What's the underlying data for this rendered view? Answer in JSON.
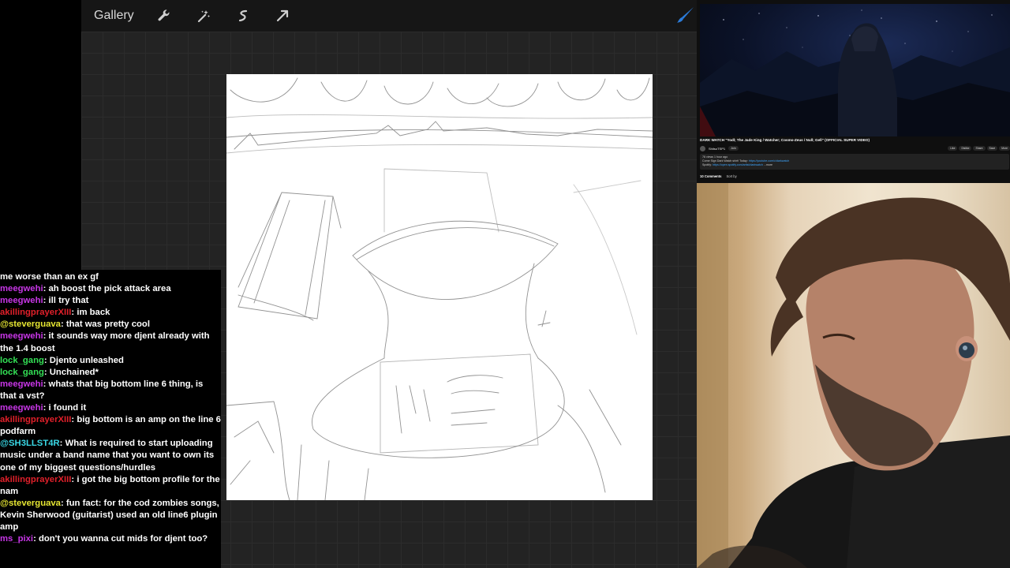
{
  "procreate": {
    "gallery_label": "Gallery",
    "tools": [
      "wrench-icon",
      "magic-wand-icon",
      "selection-icon",
      "transform-arrow-icon"
    ],
    "brush_icon": "brush-icon",
    "accent": "#2b7bd9"
  },
  "chat": {
    "messages": [
      {
        "user": "",
        "color": "#ffffff",
        "text": "me worse than an ex gf"
      },
      {
        "user": "meegwehi",
        "color": "#c736e6",
        "text": ": ah boost the pick attack area"
      },
      {
        "user": "meegwehi",
        "color": "#c736e6",
        "text": ": ill try that"
      },
      {
        "user": "akillingprayerXIII",
        "color": "#e0202a",
        "text": ": im back"
      },
      {
        "user": "@steverguava",
        "color": "#e6e633",
        "text": ": that was pretty cool"
      },
      {
        "user": "meegwehi",
        "color": "#c736e6",
        "text": ": it sounds way more djent already with the 1.4 boost"
      },
      {
        "user": "lock_gang",
        "color": "#33e055",
        "text": ": Djento unleashed"
      },
      {
        "user": "lock_gang",
        "color": "#33e055",
        "text": ": Unchained*"
      },
      {
        "user": "meegwehi",
        "color": "#c736e6",
        "text": ": whats that big bottom line 6 thing, is that a vst?"
      },
      {
        "user": "meegwehi",
        "color": "#c736e6",
        "text": ": i found it"
      },
      {
        "user": "akillingprayerXIII",
        "color": "#e0202a",
        "text": ": big bottom is an amp on the line 6 podfarm"
      },
      {
        "user": "@SH3LLST4R",
        "color": "#3ad8e6",
        "text": ": What is required to start uploading music under a band name that you want to own its one of my biggest questions/hurdles"
      },
      {
        "user": "akillingprayerXIII",
        "color": "#e0202a",
        "text": ": i got the big bottom profile for the nam"
      },
      {
        "user": "@steverguava",
        "color": "#e6e633",
        "text": ": fun fact: for the cod zombies songs, Kevin Sherwood (guitarist) used an old line6 plugin amp"
      },
      {
        "user": "ms_pixi",
        "color": "#c736e6",
        "text": ": don't you wanna cut mids for djent too?"
      }
    ]
  },
  "youtube": {
    "title": "DARK WATCH \"Yodl; The Jade King / Watcher; Cosmo-Zeus / Null; Gell\" (OFFICIAL SUPER VIDEO)",
    "channel": "ShitsoTSP1",
    "subscribe": "Join",
    "actions": [
      "Like",
      "Dislike",
      "Share",
      "Save",
      "More"
    ],
    "desc_line1": "78 views  1 hour ago",
    "desc_line2_prefix": "Come Sign Dark Watch shirt! Today: ",
    "desc_line2_link": "https://youtube.com/c/darkwatch",
    "desc_line3_prefix": "Spotify: ",
    "desc_line3_link": "https://open.spotify.com/artist/darkwatch",
    "desc_more": "...more",
    "comments_count": "10 Comments",
    "sort_label": "Sort by"
  }
}
